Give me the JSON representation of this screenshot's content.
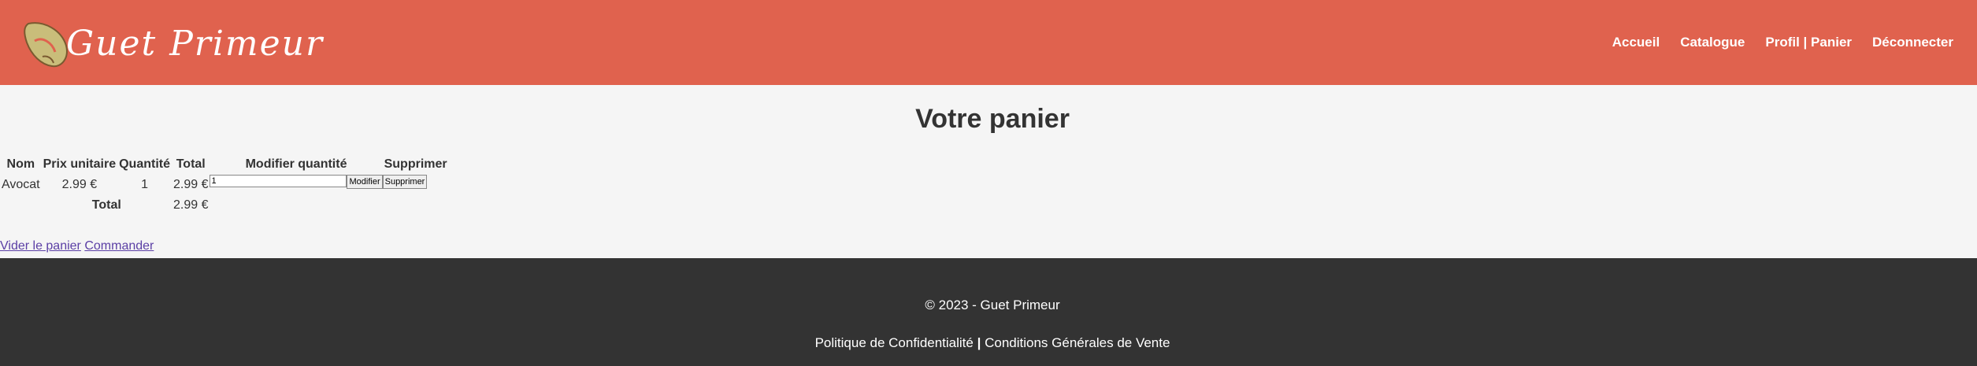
{
  "header": {
    "logo_text": "Guet Primeur",
    "nav": [
      {
        "label": "Accueil"
      },
      {
        "label": "Catalogue"
      },
      {
        "label": "Profil | Panier"
      },
      {
        "label": "Déconnecter"
      }
    ]
  },
  "main": {
    "title": "Votre panier",
    "table": {
      "headers": [
        "Nom",
        "Prix unitaire",
        "Quantité",
        "Total",
        "Modifier quantité",
        "Supprimer"
      ],
      "rows": [
        {
          "nom": "Avocat",
          "prix": "2.99 €",
          "quantite": "1",
          "total": "2.99 €",
          "qty_input_value": "1",
          "modify_label": "Modifier",
          "delete_label": "Supprimer"
        }
      ],
      "total_label": "Total",
      "total_value": "2.99 €"
    },
    "links": {
      "empty_cart": "Vider le panier",
      "order": "Commander"
    }
  },
  "footer": {
    "copyright": "© 2023 - Guet Primeur",
    "privacy": "Politique de Confidentialité",
    "separator": "|",
    "terms": "Conditions Générales de Vente"
  },
  "colors": {
    "header_bg": "#e0624e",
    "footer_bg": "#333333",
    "page_bg": "#f5f5f5",
    "link": "#5b3fa5"
  }
}
